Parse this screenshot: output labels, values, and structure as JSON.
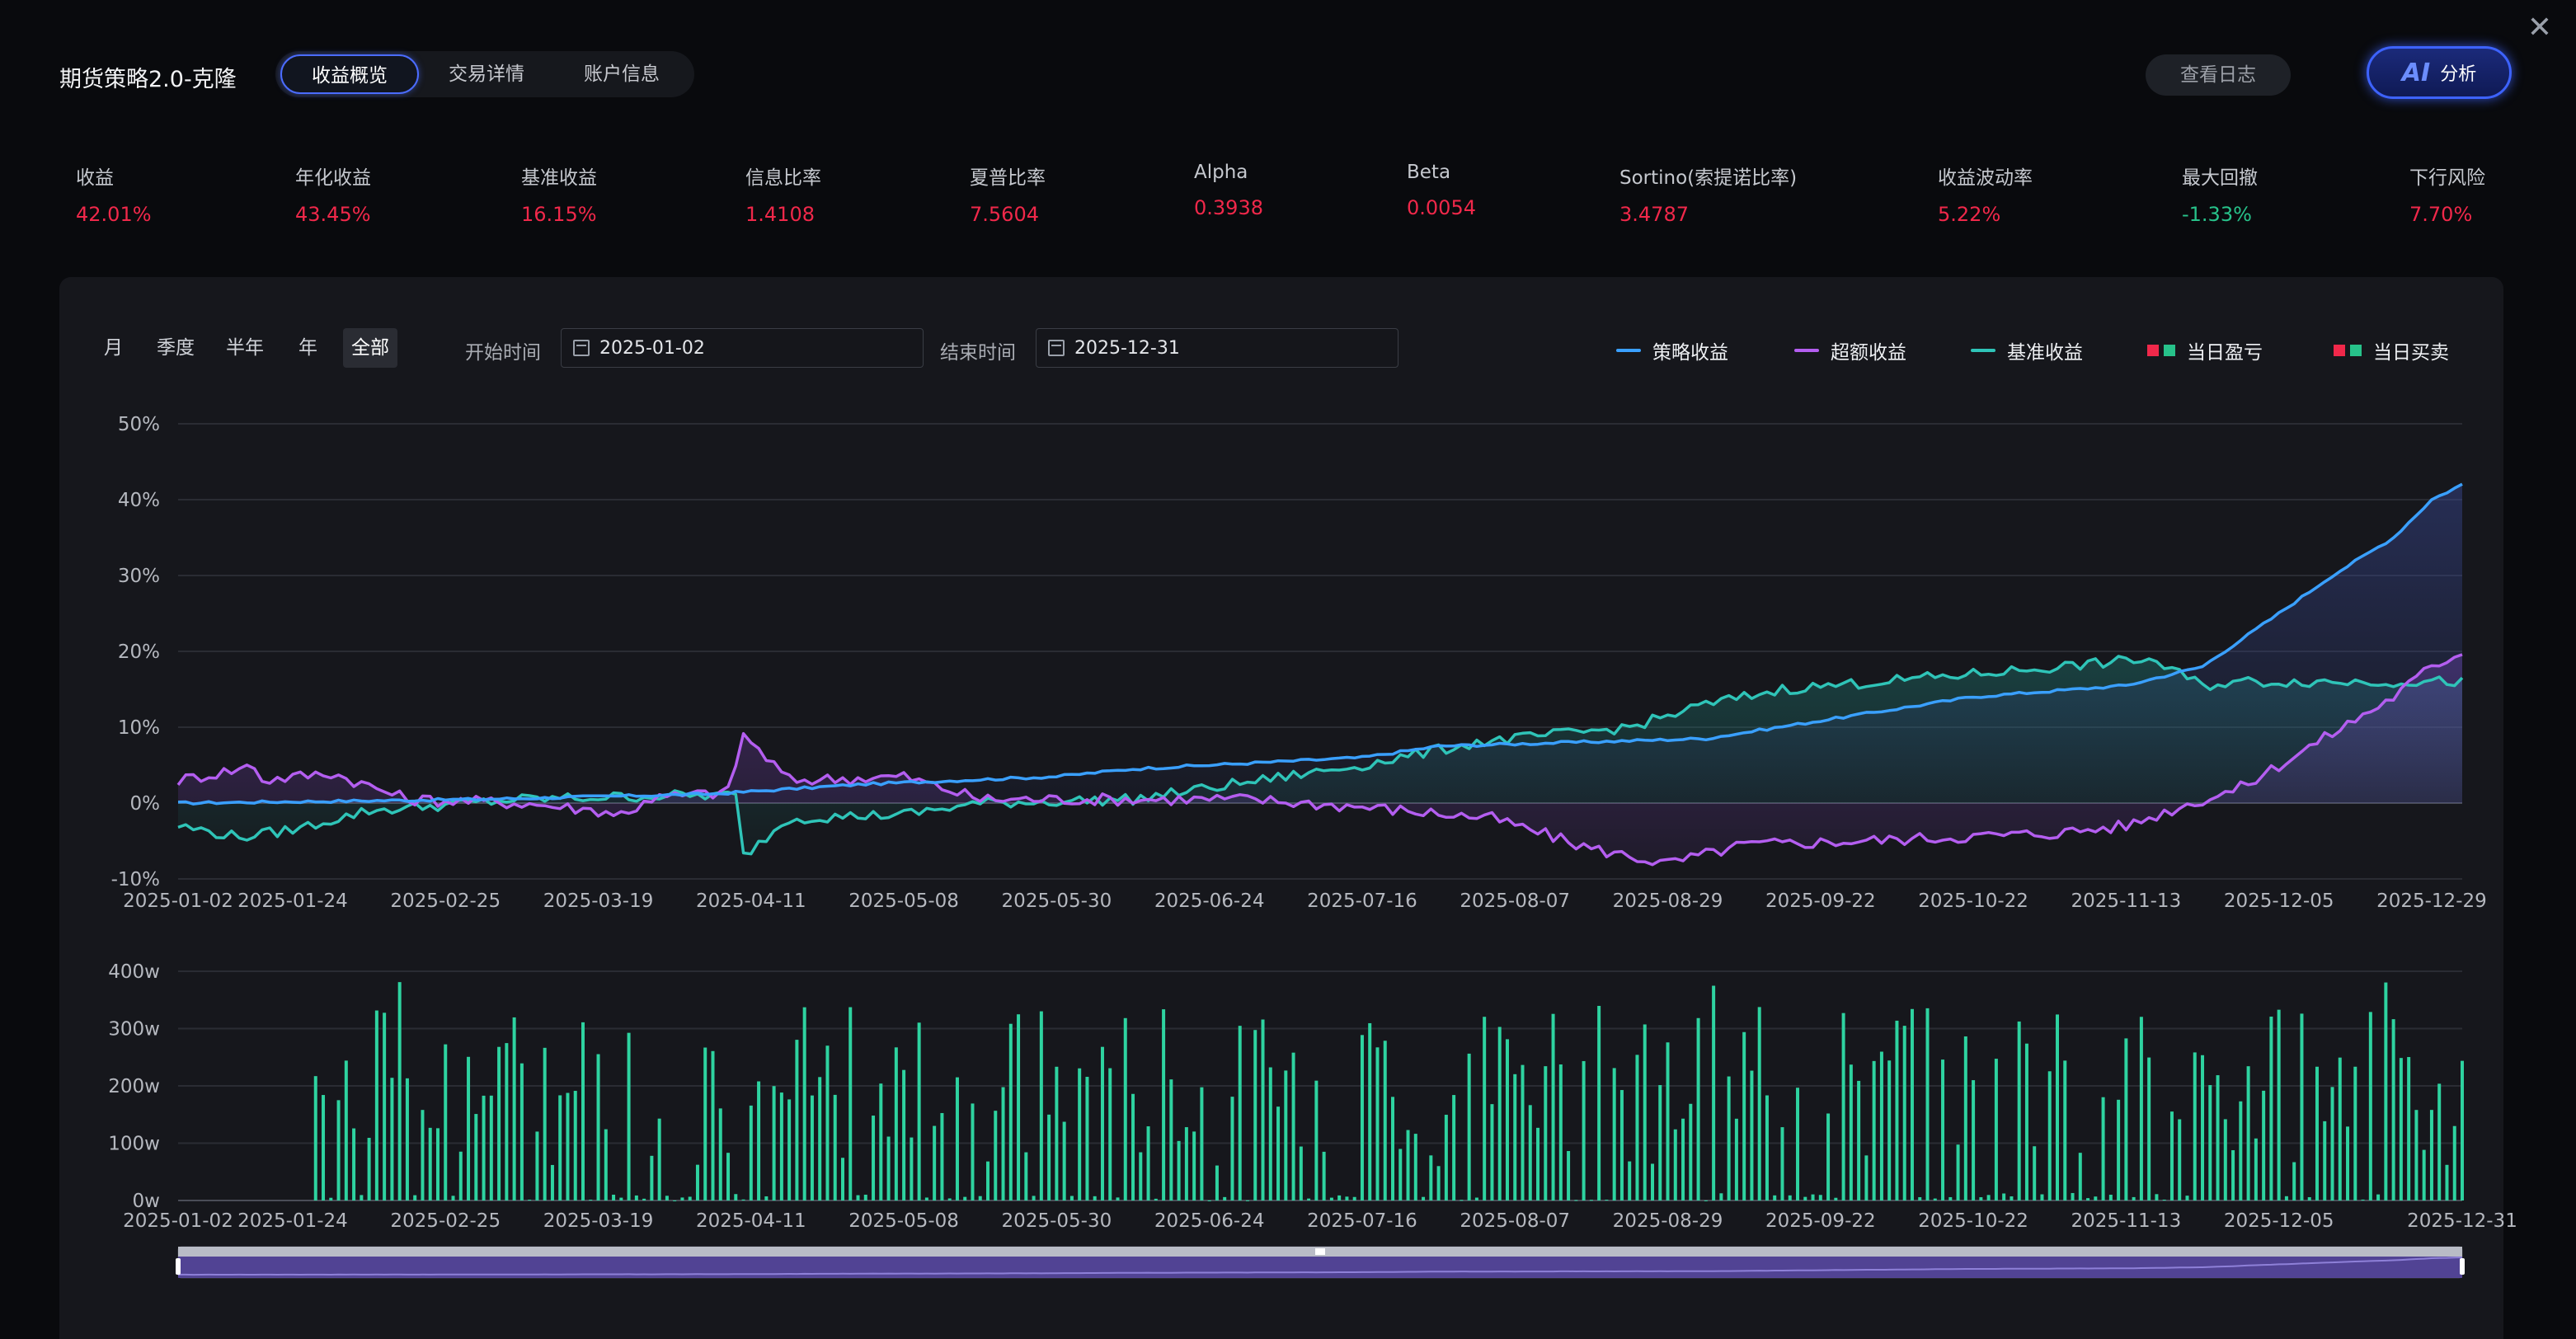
{
  "dialog": {
    "title": "期货策略2.0-克隆",
    "close_icon": "close-icon",
    "tabs": [
      {
        "label": "收益概览",
        "active": true
      },
      {
        "label": "交易详情",
        "active": false
      },
      {
        "label": "账户信息",
        "active": false
      }
    ],
    "log_button": "查看日志",
    "ai_button": {
      "logo": "AI",
      "label": "分析"
    }
  },
  "metrics": [
    {
      "label": "收益",
      "value": "42.01%",
      "tone": "up"
    },
    {
      "label": "年化收益",
      "value": "43.45%",
      "tone": "up"
    },
    {
      "label": "基准收益",
      "value": "16.15%",
      "tone": "up"
    },
    {
      "label": "信息比率",
      "value": "1.4108",
      "tone": "up"
    },
    {
      "label": "夏普比率",
      "value": "7.5604",
      "tone": "up"
    },
    {
      "label": "Alpha",
      "value": "0.3938",
      "tone": "up"
    },
    {
      "label": "Beta",
      "value": "0.0054",
      "tone": "up"
    },
    {
      "label": "Sortino(索提诺比率)",
      "value": "3.4787",
      "tone": "up"
    },
    {
      "label": "收益波动率",
      "value": "5.22%",
      "tone": "up"
    },
    {
      "label": "最大回撤",
      "value": "-1.33%",
      "tone": "down"
    },
    {
      "label": "下行风险",
      "value": "7.70%",
      "tone": "up"
    }
  ],
  "colors": {
    "up": "#f0284a",
    "down": "#27c28a",
    "strategy": "#3aa0ff",
    "excess": "#b45ef0",
    "benchmark": "#2fc4b8",
    "bar": "#2ed3a0",
    "slider": "#5b4aa8"
  },
  "toolbar": {
    "periods": [
      {
        "label": "月",
        "active": false
      },
      {
        "label": "季度",
        "active": false
      },
      {
        "label": "半年",
        "active": false
      },
      {
        "label": "年",
        "active": false
      },
      {
        "label": "全部",
        "active": true
      }
    ],
    "start_label": "开始时间",
    "start_value": "2025-01-02",
    "end_label": "结束时间",
    "end_value": "2025-12-31",
    "calendar_icon": "calendar-icon"
  },
  "legend": [
    {
      "label": "策略收益",
      "kind": "line",
      "color": "#3aa0ff"
    },
    {
      "label": "超额收益",
      "kind": "line",
      "color": "#b45ef0"
    },
    {
      "label": "基准收益",
      "kind": "line",
      "color": "#2fc4b8"
    },
    {
      "label": "当日盈亏",
      "kind": "squares",
      "colors": [
        "#f0284a",
        "#27c28a"
      ]
    },
    {
      "label": "当日买卖",
      "kind": "squares",
      "colors": [
        "#f0284a",
        "#27c28a"
      ]
    }
  ],
  "chart_data": [
    {
      "type": "line",
      "ylim": [
        -10,
        50
      ],
      "yticks": [
        "-10%",
        "0%",
        "10%",
        "20%",
        "30%",
        "40%",
        "50%"
      ],
      "x_tick_labels": [
        "2025-01-02",
        "2025-01-24",
        "2025-02-25",
        "2025-03-19",
        "2025-04-11",
        "2025-05-08",
        "2025-05-30",
        "2025-06-24",
        "2025-07-16",
        "2025-08-07",
        "2025-08-29",
        "2025-09-22",
        "2025-10-22",
        "2025-11-13",
        "2025-12-05",
        "2025-12-29"
      ],
      "x_tick_index": [
        0,
        15,
        35,
        55,
        75,
        95,
        115,
        135,
        155,
        175,
        195,
        215,
        235,
        255,
        275,
        295
      ],
      "n_points": 300,
      "series": [
        {
          "name": "策略收益",
          "color": "#3aa0ff",
          "knots": [
            [
              0,
              0
            ],
            [
              40,
              0.5
            ],
            [
              70,
              1.2
            ],
            [
              90,
              2.5
            ],
            [
              115,
              3.5
            ],
            [
              125,
              4.5
            ],
            [
              155,
              6
            ],
            [
              165,
              7.5
            ],
            [
              200,
              8.5
            ],
            [
              235,
              14
            ],
            [
              255,
              15.5
            ],
            [
              265,
              18
            ],
            [
              275,
              25
            ],
            [
              282,
              30
            ],
            [
              290,
              35
            ],
            [
              295,
              40
            ],
            [
              299,
              42
            ]
          ]
        },
        {
          "name": "超额收益",
          "color": "#b45ef0",
          "knots": [
            [
              0,
              3
            ],
            [
              8,
              4.5
            ],
            [
              10,
              5
            ],
            [
              11,
              3
            ],
            [
              20,
              4
            ],
            [
              30,
              0.5
            ],
            [
              45,
              0
            ],
            [
              55,
              -1
            ],
            [
              59,
              -1.5
            ],
            [
              61,
              0.5
            ],
            [
              72,
              1.5
            ],
            [
              74,
              9
            ],
            [
              80,
              3
            ],
            [
              95,
              3.5
            ],
            [
              105,
              0.5
            ],
            [
              140,
              0.5
            ],
            [
              155,
              -0.5
            ],
            [
              172,
              -2
            ],
            [
              185,
              -6
            ],
            [
              195,
              -8
            ],
            [
              205,
              -5.5
            ],
            [
              220,
              -5
            ],
            [
              232,
              -4.5
            ],
            [
              245,
              -4
            ],
            [
              255,
              -3
            ],
            [
              262,
              -0.5
            ],
            [
              270,
              2
            ],
            [
              280,
              8
            ],
            [
              290,
              14
            ],
            [
              295,
              18
            ],
            [
              299,
              20
            ]
          ]
        },
        {
          "name": "基准收益",
          "color": "#2fc4b8",
          "knots": [
            [
              0,
              -3
            ],
            [
              8,
              -4.5
            ],
            [
              15,
              -3.5
            ],
            [
              25,
              -1
            ],
            [
              45,
              0.5
            ],
            [
              65,
              1
            ],
            [
              73,
              1
            ],
            [
              74,
              -7
            ],
            [
              80,
              -2
            ],
            [
              95,
              -1.5
            ],
            [
              105,
              0
            ],
            [
              125,
              0.5
            ],
            [
              155,
              5
            ],
            [
              170,
              8
            ],
            [
              190,
              10
            ],
            [
              200,
              13
            ],
            [
              210,
              15
            ],
            [
              235,
              17
            ],
            [
              258,
              19
            ],
            [
              262,
              17
            ],
            [
              265,
              15.5
            ],
            [
              270,
              16
            ],
            [
              299,
              16
            ]
          ]
        }
      ]
    },
    {
      "type": "bar",
      "name": "当日买卖",
      "ylim": [
        0,
        400
      ],
      "yticks": [
        "0w",
        "100w",
        "200w",
        "300w",
        "400w"
      ],
      "x_tick_labels": [
        "2025-01-02",
        "2025-01-24",
        "2025-02-25",
        "2025-03-19",
        "2025-04-11",
        "2025-05-08",
        "2025-05-30",
        "2025-06-24",
        "2025-07-16",
        "2025-08-07",
        "2025-08-29",
        "2025-09-22",
        "2025-10-22",
        "2025-11-13",
        "2025-12-05",
        "2025-12-31"
      ],
      "x_tick_index": [
        0,
        15,
        35,
        55,
        75,
        95,
        115,
        135,
        155,
        175,
        195,
        215,
        235,
        255,
        275,
        299
      ],
      "n_points": 300,
      "approx_range": [
        0,
        390
      ],
      "peak_max": 390
    }
  ],
  "zoom_slider": {
    "start_pct": 0,
    "end_pct": 100
  }
}
